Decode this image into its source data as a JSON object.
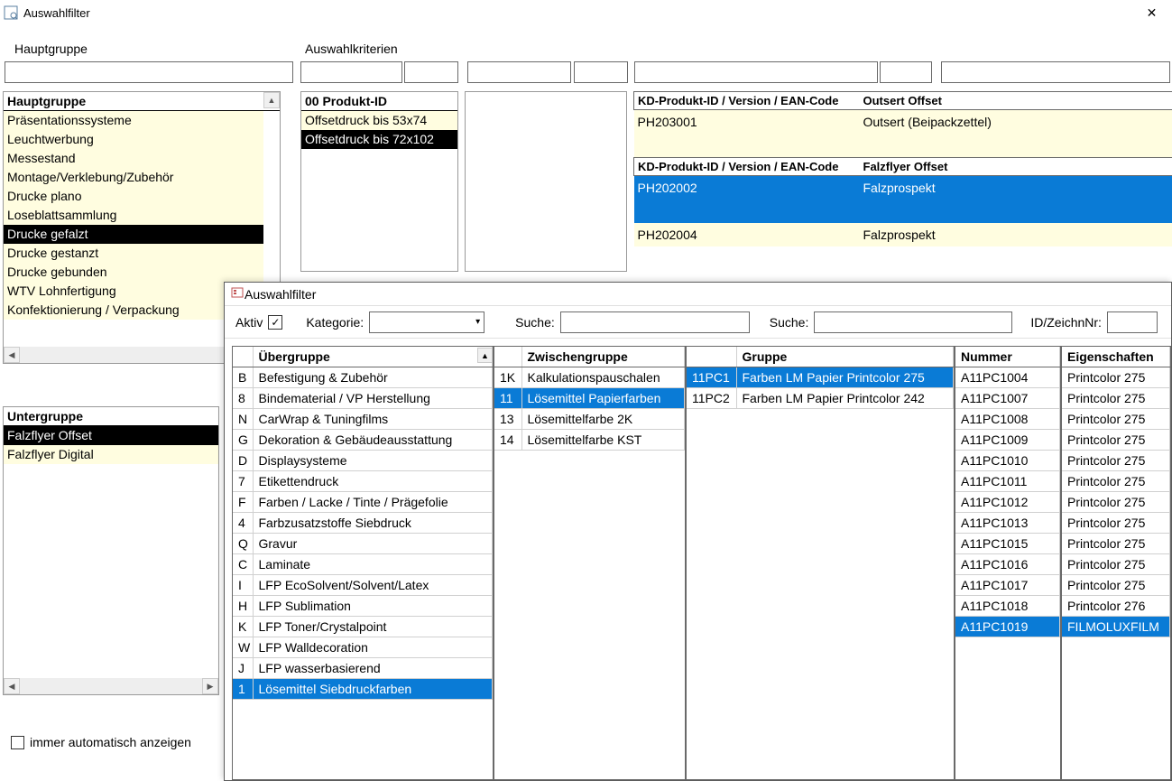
{
  "win1": {
    "title": "Auswahlfilter",
    "close": "✕",
    "labels": {
      "hauptgruppe_caption": "Hauptgruppe",
      "auswahlkriterien": "Auswahlkriterien",
      "immer_auto": "immer automatisch  anzeigen"
    },
    "hauptgruppe": {
      "header": "Hauptgruppe",
      "items": [
        "Präsentationssysteme",
        "Leuchtwerbung",
        "Messestand",
        "Montage/Verklebung/Zubehör",
        "Drucke plano",
        "Loseblattsammlung",
        "Drucke gefalzt",
        "Drucke gestanzt",
        "Drucke gebunden",
        "WTV Lohnfertigung",
        "Konfektionierung / Verpackung"
      ],
      "selected_index": 6
    },
    "untergruppe": {
      "header": "Untergruppe",
      "items": [
        "Falzflyer Offset",
        "Falzflyer Digital"
      ],
      "selected_index": 0
    },
    "produkt_id": {
      "header": "00 Produkt-ID",
      "items": [
        "Offsetdruck bis 53x74",
        "Offsetdruck bis 72x102"
      ],
      "selected_index": 1
    },
    "kd": {
      "sections": [
        {
          "header_left": "KD-Produkt-ID / Version / EAN-Code",
          "header_right": "Outsert Offset",
          "rows": [
            {
              "id": "PH203001",
              "name": "Outsert (Beipackzettel)",
              "sel": false
            }
          ]
        },
        {
          "header_left": "KD-Produkt-ID / Version / EAN-Code",
          "header_right": "Falzflyer Offset",
          "rows": [
            {
              "id": "PH202002",
              "name": "Falzprospekt",
              "sel": true
            },
            {
              "id": "PH202004",
              "name": "Falzprospekt",
              "sel": false
            }
          ]
        }
      ]
    }
  },
  "win2": {
    "title": "Auswahlfilter",
    "filters": {
      "aktiv_label": "Aktiv",
      "aktiv_checked": true,
      "kategorie_label": "Kategorie:",
      "suche_label": "Suche:",
      "id_label": "ID/ZeichnNr:"
    },
    "uebergruppe": {
      "header_code": "",
      "header": "Übergruppe",
      "rows": [
        {
          "c": "B",
          "n": "Befestigung & Zubehör"
        },
        {
          "c": "8",
          "n": "Bindematerial / VP Herstellung"
        },
        {
          "c": "N",
          "n": "CarWrap & Tuningfilms"
        },
        {
          "c": "G",
          "n": "Dekoration & Gebäudeausstattung"
        },
        {
          "c": "D",
          "n": "Displaysysteme"
        },
        {
          "c": "7",
          "n": "Etikettendruck"
        },
        {
          "c": "F",
          "n": "Farben / Lacke / Tinte / Prägefolie"
        },
        {
          "c": "4",
          "n": "Farbzusatzstoffe Siebdruck"
        },
        {
          "c": "Q",
          "n": "Gravur"
        },
        {
          "c": "C",
          "n": "Laminate"
        },
        {
          "c": "I",
          "n": "LFP EcoSolvent/Solvent/Latex"
        },
        {
          "c": "H",
          "n": "LFP Sublimation"
        },
        {
          "c": "K",
          "n": "LFP Toner/Crystalpoint"
        },
        {
          "c": "W",
          "n": "LFP Walldecoration"
        },
        {
          "c": "J",
          "n": "LFP wasserbasierend"
        },
        {
          "c": "1",
          "n": "Lösemittel Siebdruckfarben"
        }
      ],
      "selected_index": 15
    },
    "zwischengruppe": {
      "header": "Zwischengruppe",
      "rows": [
        {
          "c": "1K",
          "n": "Kalkulationspauschalen"
        },
        {
          "c": "11",
          "n": "Lösemittel Papierfarben"
        },
        {
          "c": "13",
          "n": "Lösemittelfarbe 2K"
        },
        {
          "c": "14",
          "n": "Lösemittelfarbe KST"
        }
      ],
      "selected_index": 1
    },
    "gruppe": {
      "header": "Gruppe",
      "rows": [
        {
          "c": "11PC1",
          "n": "Farben LM Papier Printcolor 275"
        },
        {
          "c": "11PC2",
          "n": "Farben LM Papier Printcolor 242"
        }
      ],
      "selected_index": 0
    },
    "nummer": {
      "header": "Nummer",
      "rows": [
        "A11PC1004",
        "A11PC1007",
        "A11PC1008",
        "A11PC1009",
        "A11PC1010",
        "A11PC1011",
        "A11PC1012",
        "A11PC1013",
        "A11PC1015",
        "A11PC1016",
        "A11PC1017",
        "A11PC1018",
        "A11PC1019"
      ],
      "selected_index": 12
    },
    "eigenschaften": {
      "header": "Eigenschaften",
      "rows": [
        "Printcolor  275",
        "Printcolor 275 ",
        "Printcolor 275 ",
        "Printcolor 275 ",
        "Printcolor 275 ",
        "Printcolor 275 ",
        "Printcolor 275 ",
        "Printcolor 275 ",
        "Printcolor 275 ",
        "Printcolor 275 ",
        "Printcolor 275 ",
        "Printcolor 276 ",
        "FILMOLUXFILM"
      ],
      "selected_index": 12
    }
  }
}
